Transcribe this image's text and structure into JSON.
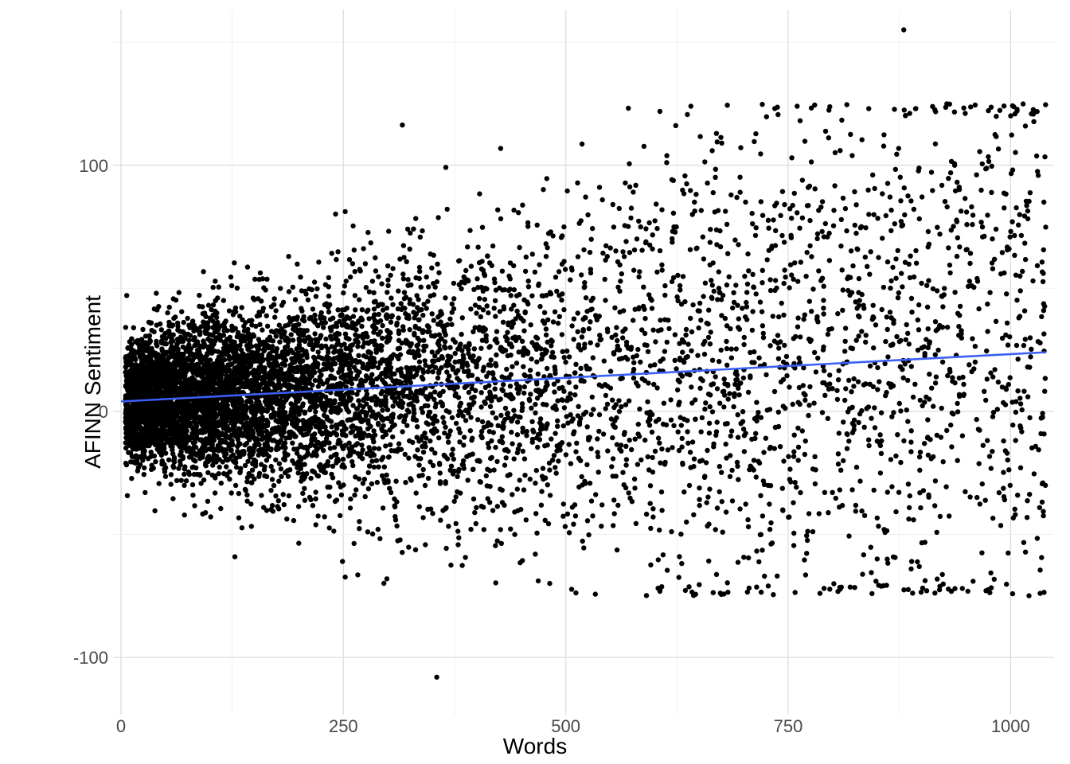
{
  "chart_data": {
    "type": "scatter",
    "title": "",
    "xlabel": "Words",
    "ylabel": "AFINN Sentiment",
    "xlim": [
      0,
      1040
    ],
    "ylim": [
      -120,
      160
    ],
    "x_ticks": [
      0,
      250,
      500,
      750,
      1000
    ],
    "y_ticks": [
      -100,
      0,
      100
    ],
    "grid": true,
    "note": "Dense scatter cloud of many thousands of points is procedurally regenerated to visually match the image; individual point coordinates are not enumerable from the raster.",
    "cloud": {
      "n_points": 7500,
      "x_density_mode": 150,
      "x_max": 1040,
      "y_center_intercept": 4,
      "y_center_slope_per_x": 0.019,
      "y_spread_base": 11,
      "y_spread_growth_per_x": 0.05
    },
    "trend_line": {
      "x": [
        0,
        1040
      ],
      "y": [
        4,
        24
      ]
    },
    "outliers": [
      {
        "x": 880,
        "y": 155
      },
      {
        "x": 355,
        "y": -108
      }
    ],
    "point_radius_px": 4,
    "colors": {
      "points": "#000000",
      "trend": "#3a60f6",
      "grid_major": "#dfdfdf",
      "grid_minor": "#efefef",
      "background": "#ffffff"
    }
  }
}
